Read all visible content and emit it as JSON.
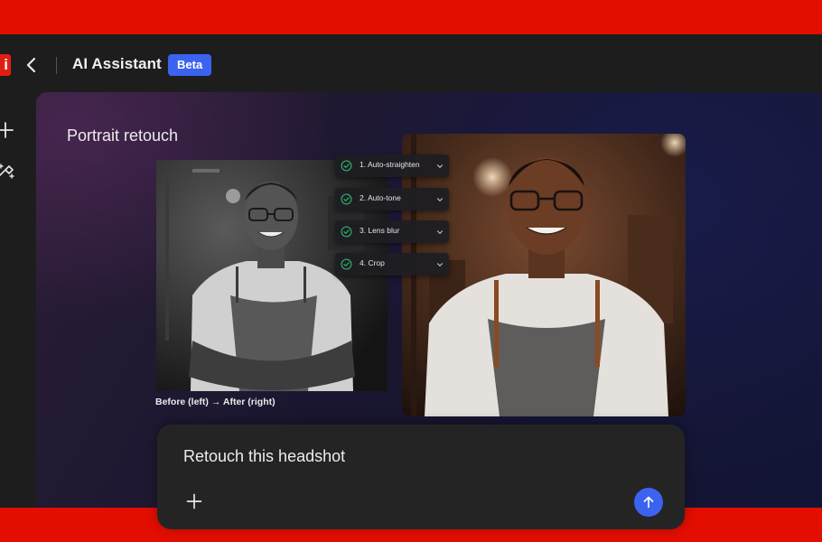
{
  "header": {
    "app_logo_text": "i",
    "title": "AI Assistant",
    "badge": "Beta"
  },
  "canvas": {
    "section_title": "Portrait retouch",
    "caption": "Before (left) → After (right)",
    "steps": [
      {
        "label": "1. Auto-straighten"
      },
      {
        "label": "2. Auto-tone"
      },
      {
        "label": "3. Lens blur"
      },
      {
        "label": "4. Crop"
      }
    ]
  },
  "prompt": {
    "text": "Retouch this headshot"
  },
  "colors": {
    "brand_red": "#e30e00",
    "accent_blue": "#3c63f0",
    "check_green": "#2fb36a"
  },
  "icons": [
    "back-chevron-icon",
    "plus-icon",
    "magic-tool-icon",
    "check-circle-icon",
    "chevron-down-icon",
    "arrow-up-icon"
  ]
}
